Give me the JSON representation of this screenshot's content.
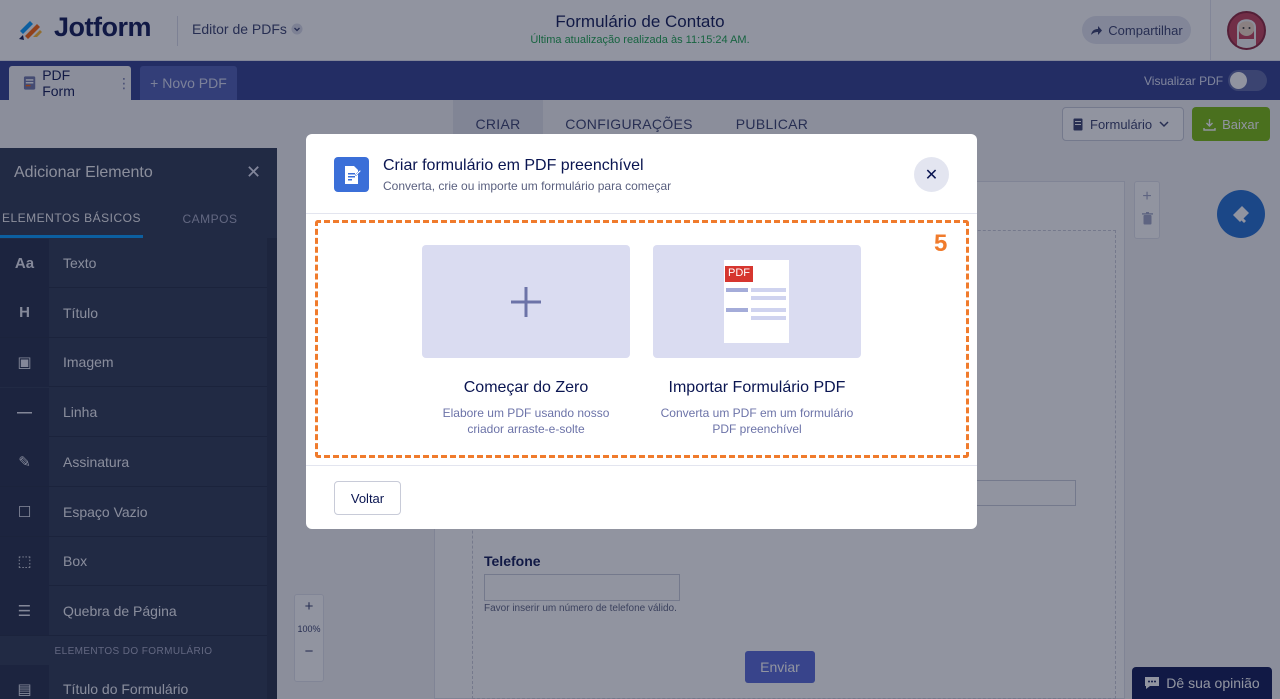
{
  "header": {
    "logo_text": "Jotform",
    "editor_menu": "Editor de PDFs",
    "form_title": "Formulário de Contato",
    "last_saved": "Última atualização realizada às 11:15:24 AM.",
    "share_label": "Compartilhar"
  },
  "tabs": {
    "pdf_form": "PDF Form",
    "new_pdf": "+ Novo PDF",
    "preview_label": "Visualizar PDF"
  },
  "nav": {
    "create": "CRIAR",
    "settings": "CONFIGURAÇÕES",
    "publish": "PUBLICAR",
    "form_select": "Formulário",
    "download": "Baixar"
  },
  "sidebar": {
    "title": "Adicionar Elemento",
    "tab_basic": "ELEMENTOS BÁSICOS",
    "tab_fields": "CAMPOS",
    "items": [
      {
        "label": "Texto",
        "icon": "text-icon",
        "glyph": "Aa"
      },
      {
        "label": "Título",
        "icon": "heading-icon",
        "glyph": "H"
      },
      {
        "label": "Imagem",
        "icon": "image-icon",
        "glyph": "▣"
      },
      {
        "label": "Linha",
        "icon": "line-icon",
        "glyph": "—"
      },
      {
        "label": "Assinatura",
        "icon": "signature-icon",
        "glyph": "✎"
      },
      {
        "label": "Espaço Vazio",
        "icon": "empty-space-icon",
        "glyph": "☐"
      },
      {
        "label": "Box",
        "icon": "box-icon",
        "glyph": "⬚"
      },
      {
        "label": "Quebra de Página",
        "icon": "page-break-icon",
        "glyph": "☰"
      }
    ],
    "section_form": "ELEMENTOS DO FORMULÁRIO",
    "form_items": [
      {
        "label": "Título do Formulário",
        "icon": "form-title-icon",
        "glyph": "▤"
      }
    ]
  },
  "canvas": {
    "phone_label": "Telefone",
    "phone_help": "Favor inserir um número de telefone válido.",
    "submit_label": "Enviar",
    "zoom_plus": "+",
    "zoom_level": "100%",
    "zoom_minus": "−",
    "page_add": "+",
    "feedback_label": "Dê sua opinião"
  },
  "modal": {
    "title": "Criar formulário em PDF preenchível",
    "subtitle": "Converta, crie ou importe um formulário para começar",
    "step_number": "5",
    "cards": [
      {
        "title": "Começar do Zero",
        "description": "Elabore um PDF usando nosso criador arraste-e-solte"
      },
      {
        "title": "Importar Formulário PDF",
        "description": "Converta um PDF em um formulário PDF preenchível",
        "badge": "PDF"
      }
    ],
    "back_label": "Voltar"
  },
  "colors": {
    "brand_navy": "#0a1551",
    "tab_bar": "#2c3a8c",
    "download_green": "#78bb07",
    "highlight_orange": "#f07b2c",
    "modal_icon_blue": "#3b6fd8"
  }
}
